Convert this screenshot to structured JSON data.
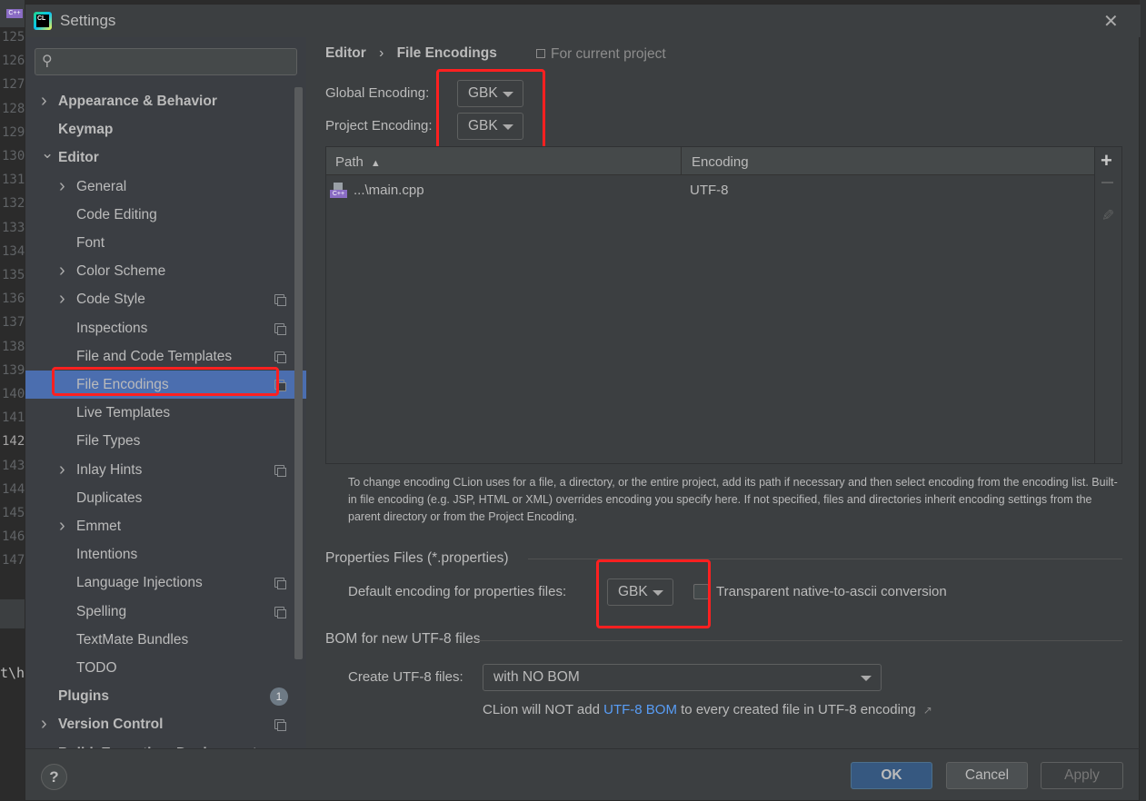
{
  "background_editor": {
    "line_numbers": [
      "125",
      "126",
      "127",
      "128",
      "129",
      "130",
      "131",
      "132",
      "133",
      "134",
      "135",
      "136",
      "137",
      "138",
      "139",
      "140",
      "141",
      "142",
      "143",
      "144",
      "145",
      "146",
      "147"
    ],
    "code_fragment": "t\\h"
  },
  "dialog": {
    "title": "Settings",
    "app_icon_text": "CL",
    "close_icon": "close-icon"
  },
  "sidebar": {
    "search_placeholder": "",
    "items": [
      {
        "label": "Appearance & Behavior",
        "level": 0,
        "expandable": true,
        "expanded": false
      },
      {
        "label": "Keymap",
        "level": 0
      },
      {
        "label": "Editor",
        "level": 0,
        "expandable": true,
        "expanded": true
      },
      {
        "label": "General",
        "level": 1,
        "expandable": true
      },
      {
        "label": "Code Editing",
        "level": 1
      },
      {
        "label": "Font",
        "level": 1
      },
      {
        "label": "Color Scheme",
        "level": 1,
        "expandable": true
      },
      {
        "label": "Code Style",
        "level": 1,
        "expandable": true,
        "project_icon": true
      },
      {
        "label": "Inspections",
        "level": 1,
        "project_icon": true
      },
      {
        "label": "File and Code Templates",
        "level": 1,
        "project_icon": true
      },
      {
        "label": "File Encodings",
        "level": 1,
        "project_icon": true,
        "selected": true
      },
      {
        "label": "Live Templates",
        "level": 1
      },
      {
        "label": "File Types",
        "level": 1
      },
      {
        "label": "Inlay Hints",
        "level": 1,
        "expandable": true,
        "project_icon": true
      },
      {
        "label": "Duplicates",
        "level": 1
      },
      {
        "label": "Emmet",
        "level": 1,
        "expandable": true
      },
      {
        "label": "Intentions",
        "level": 1
      },
      {
        "label": "Language Injections",
        "level": 1,
        "project_icon": true
      },
      {
        "label": "Spelling",
        "level": 1,
        "project_icon": true
      },
      {
        "label": "TextMate Bundles",
        "level": 1
      },
      {
        "label": "TODO",
        "level": 1
      },
      {
        "label": "Plugins",
        "level": 0,
        "badge": "1"
      },
      {
        "label": "Version Control",
        "level": 0,
        "expandable": true,
        "project_icon": true
      },
      {
        "label": "Build, Execution, Deployment",
        "level": 0,
        "expandable": true
      }
    ]
  },
  "main": {
    "breadcrumb": {
      "parent": "Editor",
      "separator": "›",
      "current": "File Encodings"
    },
    "scope_note": "For current project",
    "global_encoding": {
      "label": "Global Encoding:",
      "value": "GBK"
    },
    "project_encoding": {
      "label": "Project Encoding:",
      "value": "GBK"
    },
    "table": {
      "columns": [
        "Path",
        "Encoding"
      ],
      "sort": "Path ascending",
      "rows": [
        {
          "path": "...\\main.cpp",
          "encoding": "UTF-8",
          "icon": "cpp-file-icon"
        }
      ],
      "toolbar": [
        "add-icon",
        "remove-icon",
        "edit-icon"
      ]
    },
    "help_text": "To change encoding CLion uses for a file, a directory, or the entire project, add its path if necessary and then select encoding from the encoding list. Built-in file encoding (e.g. JSP, HTML or XML) overrides encoding you specify here. If not specified, files and directories inherit encoding settings from the parent directory or from the Project Encoding.",
    "properties_section": {
      "title": "Properties Files (*.properties)",
      "default_label": "Default encoding for properties files:",
      "default_value": "GBK",
      "transparent_label": "Transparent native-to-ascii conversion",
      "transparent_checked": false
    },
    "bom_section": {
      "title": "BOM for new UTF-8 files",
      "create_label": "Create UTF-8 files:",
      "create_value": "with NO BOM",
      "note_before": "CLion will NOT add ",
      "note_link": "UTF-8 BOM",
      "note_after": " to every created file in UTF-8 encoding",
      "note_arrow": "↗"
    }
  },
  "footer": {
    "help": "?",
    "ok": "OK",
    "cancel": "Cancel",
    "apply": "Apply"
  },
  "colors": {
    "selection": "#4b6eaf",
    "highlight_box": "#ff2020",
    "link": "#589df6",
    "ok_button": "#365880"
  }
}
